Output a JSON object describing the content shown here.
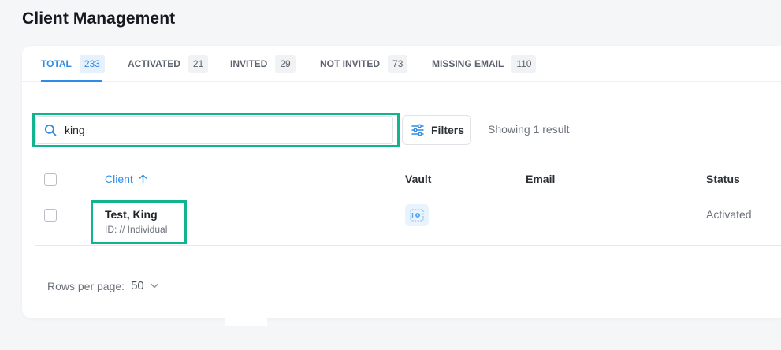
{
  "page": {
    "title": "Client Management"
  },
  "tabs": [
    {
      "label": "TOTAL",
      "count": "233",
      "active": true
    },
    {
      "label": "ACTIVATED",
      "count": "21"
    },
    {
      "label": "INVITED",
      "count": "29"
    },
    {
      "label": "NOT INVITED",
      "count": "73"
    },
    {
      "label": "MISSING EMAIL",
      "count": "110"
    }
  ],
  "search": {
    "value": "king",
    "icon": "search-icon"
  },
  "filters": {
    "label": "Filters",
    "icon": "sliders-icon"
  },
  "results": {
    "text": "Showing 1 result"
  },
  "table": {
    "headers": {
      "client": "Client",
      "vault": "Vault",
      "email": "Email",
      "status": "Status"
    },
    "rows": [
      {
        "name": "Test, King",
        "id": "ID: // Individual",
        "vault_icon": "vault-icon",
        "email": "",
        "status": "Activated"
      }
    ]
  },
  "pagination": {
    "label": "Rows per page:",
    "value": "50"
  },
  "colors": {
    "accent": "#2e8ce6",
    "highlight": "#12b48f"
  }
}
